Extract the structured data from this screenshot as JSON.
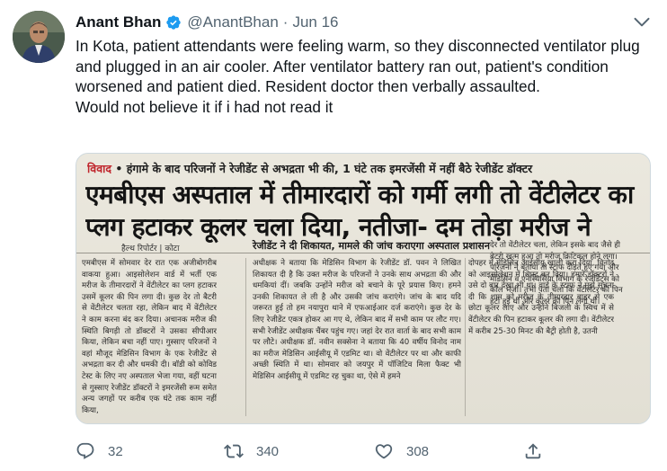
{
  "tweet": {
    "author": {
      "display_name": "Anant Bhan",
      "handle": "@AnantBhan",
      "verified": true,
      "verified_icon": "verified-badge-icon",
      "badge_color": "#1d9bf0"
    },
    "separator": "·",
    "date": "Jun 16",
    "more_icon": "more-icon",
    "text_lines": [
      "In Kota, patient attendants were feeling warm, so they disconnected ventilator plug and plugged in an air cooler. After ventilator battery ran out, patient's condition worsened and patient died. Resident doctor then verbally assaulted.",
      "Would not believe it if i had not read it"
    ],
    "media": {
      "kicker_tag": "विवाद",
      "kicker_text": "हंगामे के बाद परिजनों ने रेजीडेंट से अभद्रता भी की, 1 घंटे तक इमरजेंसी में नहीं बैठे रेजीडेंट डॉक्टर",
      "headline_line1": "एमबीएस अस्पताल में तीमारदारों को गर्मी लगी तो वेंटीलेटर का",
      "headline_line2": "प्लग हटाकर कूलर चला दिया, नतीजा- दम तोड़ा मरीज ने",
      "byline": "हैल्थ रिपोर्टर | कोटा",
      "subhead": "रेजीडेंट ने दी शिकायत, मामले की जांच कराएगा अस्पताल प्रशासन",
      "col1": "एमबीएस में सोमवार देर रात एक अजीबोगरीब वाकया हुआ। आइसोलेशन वार्ड में भर्ती एक मरीज के तीमारदारों ने वेंटीलेटर का प्लग हटाकर उसमें कूलर की पिन लगा दी। कुछ देर तो बैटरी से वेंटीलेटर चलता रहा, लेकिन बाद में वेंटीलेटर ने काम करना बंद कर दिया। अचानक मरीज की स्थिति बिगड़ी तो डॉक्टरों ने उसका सीपीआर किया, लेकिन बचा नहीं पाए। गुस्साए परिजनों ने वहां मौजूद मेडिसिन विभाग के एक रेजीडेंट से अभद्रता कर दी और धमकी दी। बॉडी को कोविड टेस्ट के लिए नए अस्पताल भेजा गया, वहीं घटना से गुस्साए रेजीडेंट डॉक्टरों ने इमरजेंसी रूम समेत अन्य जगहों पर करीब एक घंटे तक काम नहीं किया,",
      "col2": "अधीक्षक ने बताया कि मेडिसिन विभाग के रेजीडेंट डॉ. पवन ने लिखित शिकायत दी है कि उक्त मरीज के परिजनों ने उनके साथ अभद्रता की और धमकियां दीं। जबकि उन्होंने मरीज को बचाने के पूरे प्रयास किए। हमने उनकी शिकायत ले ली है और उसकी जांच कराएंगे। जांच के बाद यदि जरूरत हुई तो हम नयापुरा थाने में एफआईआर दर्ज कराएंगे। कुछ देर के लिए रेजीडेंट एकत्र होकर आ गए थे, लेकिन बाद में सभी काम पर लौट गए। सभी रेजीडेंट अधीक्षक चैंबर पहुंच गए। जहां देर रात वार्ता के बाद सभी काम पर लौटे। अधीक्षक डॉ. नवीन सक्सेना ने बताया कि 40 वर्षीय विनोद नाम का मरीज मेडिसिन आईसीयू में एडमिट था। वो वेंटीलेटर पर था और काफी अच्छी स्थिति में था। सोमवार को जयपुर में पॉजिटिव मिला फैक्ट भी मेडिसिन आईसीयू में एडमिट रह चुका था, ऐसे में हमने",
      "col3": "दोपहर में मेडिसिन आईसीयू खाली करा दिया, विनोद को आइसोलेशन में शिफ्ट कर दिया। हमारे डॉक्टरों ने उसे दो बार देखा भी था। वार्ड के स्टाफ ने मुझे सूचना दी कि शाम को मरीज के तीमारदार बाहर से एक छोटा कूलर लाए और उन्होंने बिजली के स्विच में से वेंटीलेटर की पिन हटाकर कूलर की लगा दी। वेंटीलेटर में करीब 25-30 मिनट की बैट्री होती है, उतनी",
      "right_col": "देर तो वेंटीलेटर चला, लेकिन इसके बाद जैसे ही बैटरी खत्म हुआ तो मरीज क्रिटिकल होने लगा। परिजनों ने बताया तो स्टाफ दौड़ते हुए गया और मेडिसिन व एनेस्थिसिया विभाग के रेजीडेंट्स को कॉल भेजी। तभी पता चला कि वेंटीलेटर की पिन हटी हुई थी और कूलर की पिन लगी थी।",
      "right_lower": "परेशान होते रहे मरीज, नए अस्पताल तक पहुंच गए : इस घटना के विरोध में गुस्साए रेजीडेंट्स इमरजेंसी रूम छोड़कर चले गए। इसी बीच इमरजेंसी में जब मरीज आए तो वे इधर-उधर भटकते रहे। कुछ मरीज तो नए अस्पताल पहुंच गए, लेकिन वहां से भी उन्हें लौटा दिया गया। हालांकि, कई मरीज इमरजेंसी रूम के बाहर बेंचों पर लेटे नजर आए।"
    },
    "actions": {
      "reply_icon": "reply-icon",
      "reply_count": "32",
      "retweet_icon": "retweet-icon",
      "retweet_count": "340",
      "like_icon": "heart-icon",
      "like_count": "308",
      "share_icon": "share-icon"
    }
  }
}
